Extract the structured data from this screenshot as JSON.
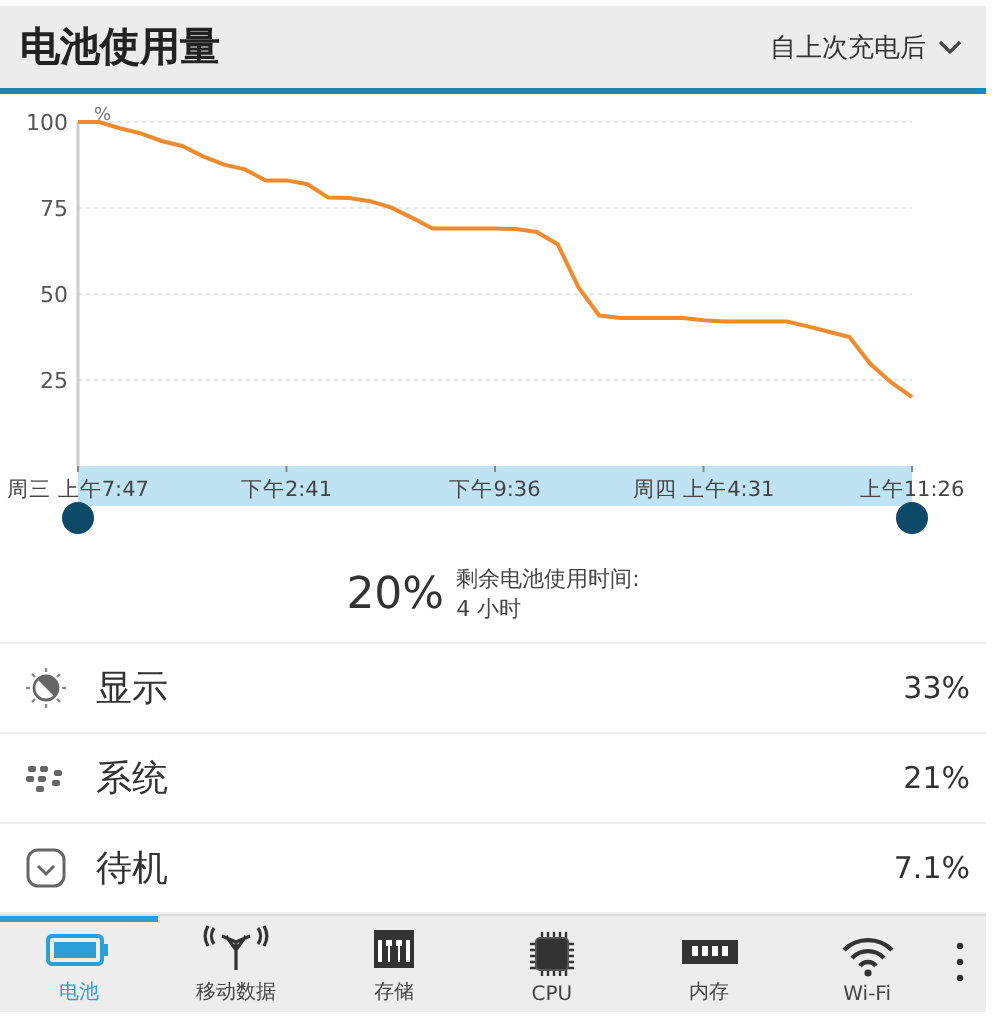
{
  "header": {
    "title": "电池使用量",
    "filter": "自上次充电后"
  },
  "chart": {
    "chart_data": {
      "type": "line",
      "ylabel": "%",
      "ylim": [
        0,
        100
      ],
      "grid": true,
      "yticks": [
        25,
        50,
        75,
        100
      ],
      "categories": [
        "周三 上午7:47",
        null,
        null,
        null,
        null,
        null,
        null,
        null,
        null,
        null,
        "下午2:41",
        null,
        null,
        null,
        null,
        null,
        null,
        null,
        null,
        null,
        "下午9:36",
        null,
        null,
        null,
        null,
        null,
        null,
        null,
        null,
        null,
        "周四 上午4:31",
        null,
        null,
        null,
        null,
        null,
        null,
        null,
        null,
        null,
        "上午11:26"
      ],
      "series": [
        {
          "color": "#f08a2c",
          "values": [
            100,
            100,
            98.2,
            96.7,
            94.5,
            93,
            90,
            87.6,
            86.2,
            83,
            83,
            81.9,
            78,
            77.9,
            77,
            75.2,
            72.2,
            69,
            69,
            69,
            69,
            68.9,
            68,
            64.5,
            52,
            43.7,
            43,
            43,
            43,
            43,
            42.4,
            42,
            42,
            42,
            42,
            40.6,
            39,
            37.5,
            29.7,
            24.3,
            20
          ]
        }
      ]
    }
  },
  "summary": {
    "percent": "20%",
    "label": "剩余电池使用时间:",
    "time": "4 小时"
  },
  "usage": [
    {
      "kind": "display",
      "name": "显示",
      "percent": "33%"
    },
    {
      "kind": "system",
      "name": "系统",
      "percent": "21%"
    },
    {
      "kind": "standby",
      "name": "待机",
      "percent": "7.1%"
    }
  ],
  "tabs": [
    {
      "kind": "battery",
      "label": "电池",
      "selected": true
    },
    {
      "kind": "antenna",
      "label": "移动数据",
      "selected": false
    },
    {
      "kind": "storage",
      "label": "存储",
      "selected": false
    },
    {
      "kind": "cpu",
      "label": "CPU",
      "selected": false
    },
    {
      "kind": "memory",
      "label": "内存",
      "selected": false
    },
    {
      "kind": "wifi",
      "label": "Wi-Fi",
      "selected": false
    }
  ]
}
